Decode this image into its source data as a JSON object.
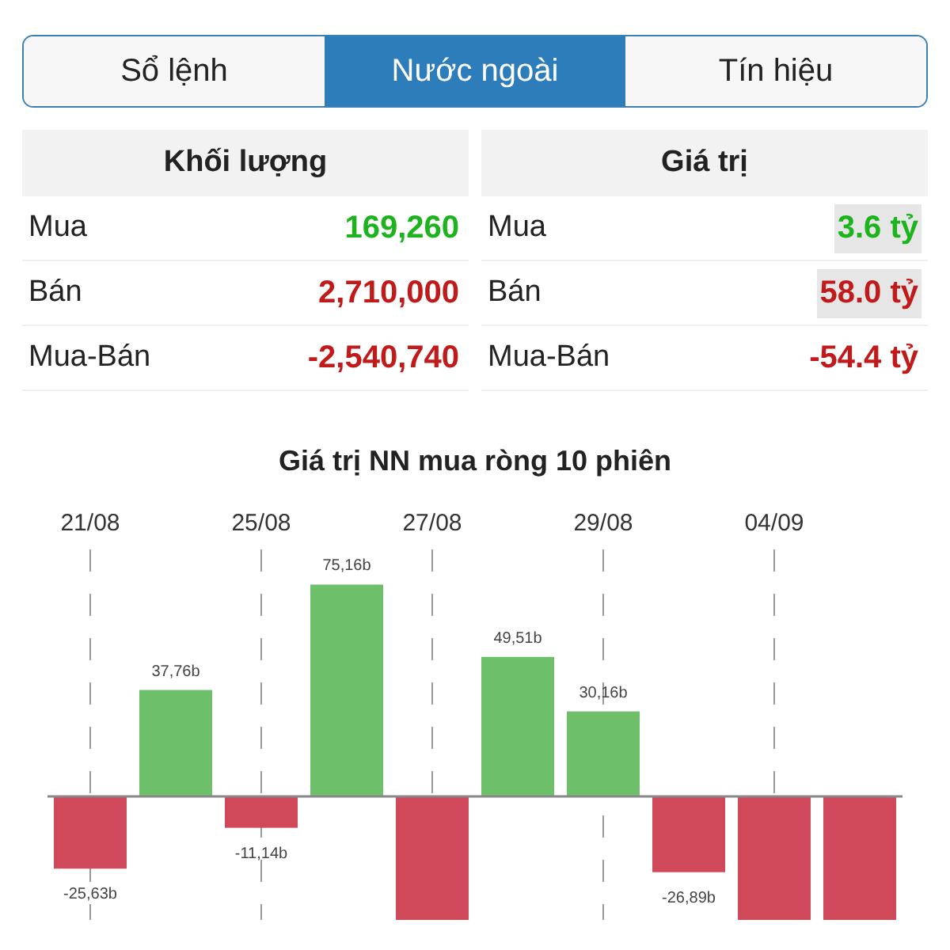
{
  "tabs": [
    {
      "label": "Sổ lệnh",
      "selected": false
    },
    {
      "label": "Nước ngoài",
      "selected": true
    },
    {
      "label": "Tín hiệu",
      "selected": false
    }
  ],
  "tables": [
    {
      "title": "Khối lượng",
      "rows": [
        {
          "label": "Mua",
          "value": "169,260",
          "color": "#1db31d",
          "highlighted": false
        },
        {
          "label": "Bán",
          "value": "2,710,000",
          "color": "#c11a1a",
          "highlighted": false
        },
        {
          "label": "Mua-Bán",
          "value": "-2,540,740",
          "color": "#c11a1a",
          "highlighted": false
        }
      ]
    },
    {
      "title": "Giá trị",
      "rows": [
        {
          "label": "Mua",
          "value": "3.6 tỷ",
          "color": "#1db31d",
          "highlighted": true
        },
        {
          "label": "Bán",
          "value": "58.0 tỷ",
          "color": "#c11a1a",
          "highlighted": true
        },
        {
          "label": "Mua-Bán",
          "value": "-54.4 tỷ",
          "color": "#c11a1a",
          "highlighted": false
        }
      ]
    }
  ],
  "chart": {
    "chart_data": {
      "type": "bar",
      "title": "Giá trị NN mua ròng 10 phiên",
      "grid": true,
      "categories": [
        "21/08",
        null,
        "25/08",
        null,
        "27/08",
        null,
        "29/08",
        null,
        "04/09",
        null
      ],
      "values": [
        -25.63,
        37.76,
        -11.14,
        75.16,
        -45,
        49.51,
        30.16,
        -26.89,
        -45,
        -45
      ],
      "value_labels": [
        "-25,63b",
        "37,76b",
        "-11,14b",
        "75,16b",
        null,
        "49,51b",
        "30,16b",
        "-26,89b",
        null,
        null
      ]
    }
  }
}
